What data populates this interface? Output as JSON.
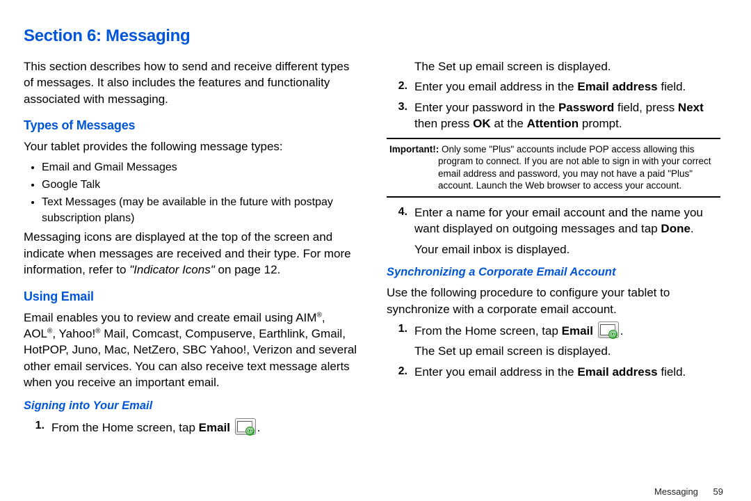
{
  "section_title": "Section 6: Messaging",
  "left": {
    "intro": "This section describes how to send and receive different types of messages. It also includes the features and functionality associated with messaging.",
    "types_heading": "Types of Messages",
    "types_intro": "Your tablet provides the following message types:",
    "types_list": [
      "Email and Gmail Messages",
      "Google Talk",
      "Text Messages (may be available in the future with postpay subscription plans)"
    ],
    "types_after_pre": "Messaging icons are displayed at the top of the screen and indicate when messages are received and their type. For more information, refer to ",
    "types_after_ref": "\"Indicator Icons\"",
    "types_after_post": " on page 12.",
    "using_heading": "Using Email",
    "using_para_a": "Email enables you to review and create email using AIM",
    "using_para_b": ", AOL",
    "using_para_c": ", Yahoo!",
    "using_para_d": " Mail, Comcast, Compuserve, Earthlink, Gmail, HotPOP, Juno, Mac, NetZero, SBC Yahoo!, Verizon and several other email services. You can also receive text message alerts when you receive an important email.",
    "signing_heading": "Signing into Your Email",
    "step1_pre": "From the Home screen, tap ",
    "step1_bold": "Email",
    "step1_post": "."
  },
  "right": {
    "r_top": "The Set up email screen is displayed.",
    "step2_pre": "Enter you email address in the ",
    "step2_bold": "Email address",
    "step2_post": " field.",
    "step3_a": "Enter your password in the ",
    "step3_b": "Password",
    "step3_c": " field, press ",
    "step3_d": "Next",
    "step3_e": " then press ",
    "step3_f": "OK",
    "step3_g": " at the ",
    "step3_h": "Attention",
    "step3_i": " prompt.",
    "note_label": "Important!:",
    "note_text": "Only some \"Plus\" accounts include POP access allowing this program to connect. If you are not able to sign in with your correct email address and password, you may not have a paid \"Plus\" account. Launch the Web browser to access your account.",
    "step4_a": "Enter a name for your email account and the name you want displayed on outgoing messages and tap ",
    "step4_b": "Done",
    "step4_c": ".",
    "step4_sub": "Your email inbox is displayed.",
    "sync_heading": "Synchronizing a Corporate Email Account",
    "sync_intro": "Use the following procedure to configure your tablet to synchronize with a corporate email account.",
    "sstep1_pre": "From the Home screen, tap ",
    "sstep1_bold": "Email",
    "sstep1_post": ".",
    "sstep1_sub": "The Set up email screen is displayed.",
    "sstep2_pre": "Enter you email address in the ",
    "sstep2_bold": "Email address",
    "sstep2_post": " field."
  },
  "footer": {
    "label": "Messaging",
    "page": "59"
  },
  "nums": {
    "n1": "1.",
    "n2": "2.",
    "n3": "3.",
    "n4": "4."
  }
}
